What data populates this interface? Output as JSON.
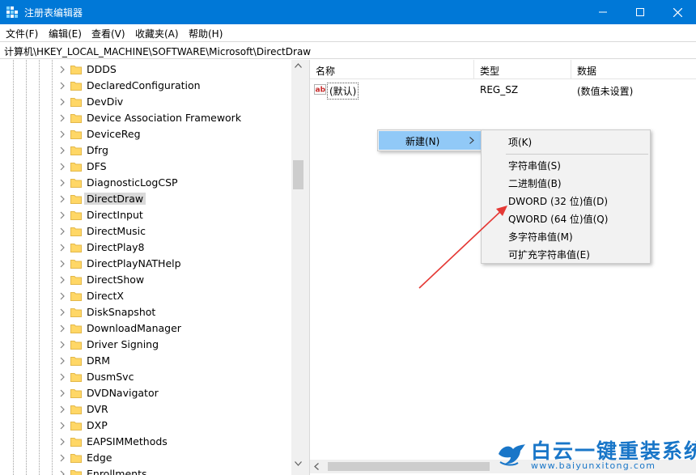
{
  "window": {
    "title": "注册表编辑器",
    "accent_color": "#0078d7",
    "controls": [
      "minimize-icon",
      "maximize-icon",
      "close-icon"
    ]
  },
  "menu": {
    "items": [
      "文件(F)",
      "编辑(E)",
      "查看(V)",
      "收藏夹(A)",
      "帮助(H)"
    ]
  },
  "address": {
    "path": "计算机\\HKEY_LOCAL_MACHINE\\SOFTWARE\\Microsoft\\DirectDraw"
  },
  "tree": {
    "selected": "DirectDraw",
    "items": [
      "DDDS",
      "DeclaredConfiguration",
      "DevDiv",
      "Device Association Framework",
      "DeviceReg",
      "Dfrg",
      "DFS",
      "DiagnosticLogCSP",
      "DirectDraw",
      "DirectInput",
      "DirectMusic",
      "DirectPlay8",
      "DirectPlayNATHelp",
      "DirectShow",
      "DirectX",
      "DiskSnapshot",
      "DownloadManager",
      "Driver Signing",
      "DRM",
      "DusmSvc",
      "DVDNavigator",
      "DVR",
      "DXP",
      "EAPSIMMethods",
      "Edge",
      "Enrollments"
    ]
  },
  "list": {
    "columns": {
      "name": "名称",
      "type": "类型",
      "data": "数据"
    },
    "rows": [
      {
        "name": "(默认)",
        "type": "REG_SZ",
        "data": "(数值未设置)",
        "icon": "string-value-icon"
      }
    ]
  },
  "context_menu": {
    "parent": {
      "label": "新建(N)",
      "highlight_color": "#91c9f7"
    },
    "submenu": {
      "key": "项(K)",
      "values": [
        "字符串值(S)",
        "二进制值(B)",
        "DWORD (32 位)值(D)",
        "QWORD (64 位)值(Q)",
        "多字符串值(M)",
        "可扩充字符串值(E)"
      ]
    }
  },
  "annotation": {
    "color": "#e53935",
    "points_to": "DWORD (32 位)值(D)"
  },
  "watermark": {
    "title": "白云一键重装系统",
    "url": "www.baiyunxitong.com",
    "color": "#1976c8"
  }
}
